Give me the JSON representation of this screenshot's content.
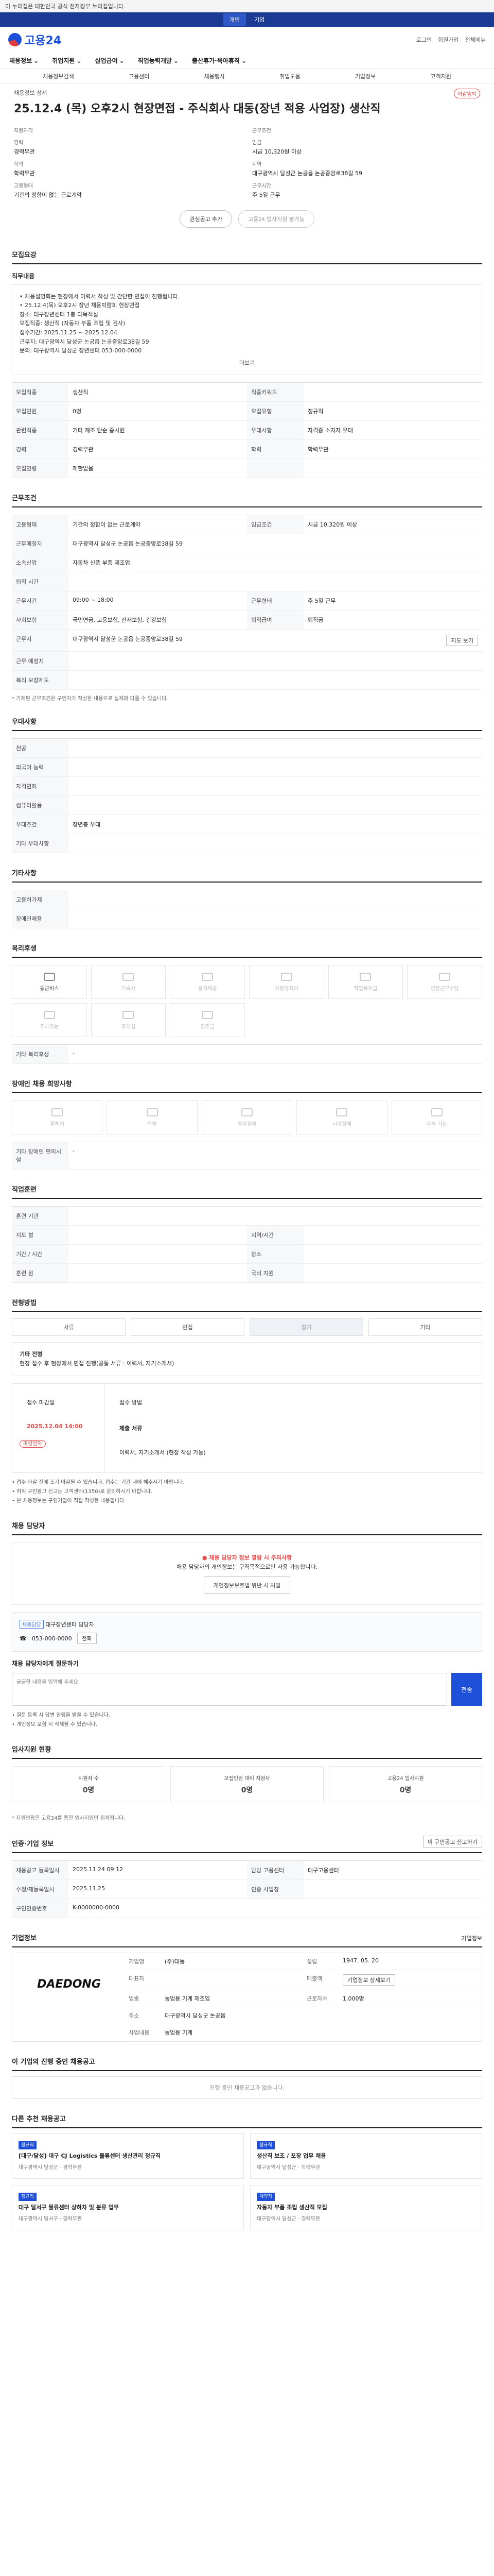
{
  "notice": "이 누리집은 대한민국 공식 전자정부 누리집입니다.",
  "govbar": {
    "items": [
      "개인",
      "기업"
    ]
  },
  "header": {
    "logo_text": "고용24",
    "links": [
      "로그인",
      "회원가입",
      "전체메뉴"
    ]
  },
  "gnb": [
    "채용정보",
    "취업지원",
    "실업급여",
    "직업능력개발",
    "출산휴가·육아휴직"
  ],
  "subnav": [
    "채용정보검색",
    "고용센터",
    "채용행사",
    "취업도움",
    "기업정보",
    "고객지원"
  ],
  "job": {
    "breadcrumb": "채용정보 상세",
    "badge": "마감임박",
    "title": "25.12.4 (목) 오후2시 현장면접 - 주식회사 대동(장년 적용 사업장) 생산직",
    "kv": [
      {
        "label": "지원자격",
        "value": ""
      },
      {
        "label": "근무조건",
        "value": ""
      },
      {
        "label": "경력",
        "value": "경력무관"
      },
      {
        "label": "임금",
        "value": "시급 10,320원 이상"
      },
      {
        "label": "학력",
        "value": "학력무관"
      },
      {
        "label": "지역",
        "value": "대구광역시 달성군 논공읍 논공중앙로38길 59"
      },
      {
        "label": "고용형태",
        "value": ""
      },
      {
        "label": "근무시간",
        "value": ""
      },
      {
        "label": "",
        "value": "기간의 정함이 없는 근로계약"
      },
      {
        "label": "",
        "value": "주 5일 근무"
      }
    ],
    "btn_interest": "관심공고 추가",
    "btn_apply": "고용24 입사지원 불가능"
  },
  "recruit": {
    "title": "모집요강",
    "content_title": "직무내용",
    "content_lines": [
      "• 채용설명회는 현장에서 이력서 작성 및 간단한 면접이 진행됩니다.",
      "• 25.12.4(목) 오후2시 장년 채용박람회 현장면접",
      "장소: 대구장년센터 1층 다목적실",
      "모집직종: 생산직 (자동차 부품 조립 및 검사)",
      "접수기간: 2025.11.25 ~ 2025.12.04",
      "근무지: 대구광역시 달성군 논공읍 논공중앙로38길 59",
      "문의: 대구광역시 달성군 장년센터 053-000-0000"
    ],
    "more": "더보기",
    "rows": [
      [
        "모집직종",
        "생산직",
        "직종키워드",
        ""
      ],
      [
        "모집인원",
        "0명",
        "모집유형",
        "정규직"
      ],
      [
        "관련직종",
        "기타 제조 단순 종사원",
        "우대사항",
        "자격증 소지자 우대"
      ],
      [
        "경력",
        "경력무관",
        "학력",
        "학력무관"
      ],
      [
        "모집연령",
        "제한없음",
        "",
        ""
      ]
    ]
  },
  "work": {
    "title": "근무조건",
    "rows": [
      [
        "고용형태",
        "기간의 정함이 없는 근로계약",
        "임금조건",
        "시급 10,320원 이상"
      ],
      [
        "근무예정지",
        "대구광역시 달성군 논공읍 논공중앙로38길 59",
        "",
        ""
      ],
      [
        "소속산업",
        "자동차 신품 부품 제조업",
        "",
        ""
      ],
      [
        "퇴직 시간",
        "",
        "",
        ""
      ],
      [
        "근무시간",
        "09:00 ~ 18:00",
        "근무형태",
        "주 5일 근무"
      ],
      [
        "사회보험",
        "국민연금, 고용보험, 산재보험, 건강보험",
        "퇴직급여",
        "퇴직금"
      ],
      [
        "근무지",
        "대구광역시 달성군 논공읍 논공중앙로38길 59",
        "",
        ""
      ],
      [
        "근무 예정지",
        "",
        "",
        ""
      ],
      [
        "복리 보장제도",
        "",
        "",
        ""
      ]
    ],
    "map_btn": "지도 보기",
    "footnote": "* 기재된 근무조건은 구인자가 작성한 내용으로 실제와 다를 수 있습니다."
  },
  "prefer": {
    "title": "우대사항",
    "rows": [
      [
        "전공",
        ""
      ],
      [
        "외국어 능력",
        ""
      ],
      [
        "자격면허",
        ""
      ],
      [
        "컴퓨터활용",
        ""
      ],
      [
        "우대조건",
        "장년층 우대"
      ],
      [
        "기타 우대사항",
        ""
      ]
    ]
  },
  "etc": {
    "title": "기타사항",
    "rows": [
      [
        "고용허가제",
        ""
      ],
      [
        "장애인채용",
        ""
      ]
    ]
  },
  "welfare": {
    "title": "복리후생",
    "items": [
      "통근버스",
      "기숙사",
      "중식제공",
      "차량유지비",
      "작업복지급",
      "연장근무수당",
      "주차가능",
      "휴게실",
      "경조금"
    ],
    "dim_from": 1,
    "etc_label": "기타 복리후생",
    "etc_value": "-"
  },
  "disability": {
    "title": "장애인 채용 희망사항",
    "items": [
      "휠체어",
      "목발",
      "청각장애",
      "시각장애",
      "주차 가능"
    ],
    "etc_label": "기타 장애인 편의시설",
    "etc_value": "-"
  },
  "career": {
    "title": "직업훈련",
    "rows": [
      [
        "훈련 기관",
        "",
        "",
        ""
      ],
      [
        "지도 형",
        "",
        "지역/시간",
        ""
      ],
      [
        "기간 / 시간",
        "",
        "장소",
        ""
      ],
      [
        "훈련 원",
        "",
        "국비 지원",
        ""
      ]
    ]
  },
  "process": {
    "title": "전형방법",
    "tabs": [
      "서류",
      "면접",
      "필기",
      "기타"
    ],
    "etc_title": "기타 전형",
    "etc_text": "현장 접수 후 현장에서 면접 진행(공통 서류 : 이력서, 자기소개서)",
    "deadline_label": "접수 마감일",
    "deadline": "2025.12.04 14:00",
    "deadline_tag": "마감임박",
    "method_label": "접수 방법",
    "method_title": "제출 서류",
    "method_text": "이력서, 자기소개서 (현장 작성 가능)",
    "notes": [
      "• 접수 마감 전에 조기 마감될 수 있습니다. 접수는 기간 내에 해주시기 바랍니다.",
      "• 허위 구인광고 신고는 고객센터(1350)로 문의하시기 바랍니다.",
      "• 본 채용정보는 구인기업이 직접 작성한 내용입니다."
    ]
  },
  "contact_info": {
    "title": "채용 담당자",
    "alert_title": "채용 담당자 정보 열람 시 주의사항",
    "alert_text": "채용 담당자의 개인정보는 구직목적으로만 사용 가능합니다.",
    "alert_btn": "개인정보보호법 위반 시 처벌",
    "contact_tag": "채용담당",
    "contact_name": "대구장년센터 담당자",
    "contact_phone": "053-000-0000",
    "call_btn": "전화",
    "inquiry_title": "채용 담당자에게 질문하기",
    "inquiry_placeholder": "궁금한 내용을 입력해 주세요.",
    "inquiry_btn": "전송",
    "inquiry_notes": [
      "• 질문 등록 시 답변 알림을 받을 수 있습니다.",
      "• 개인정보 포함 시 삭제될 수 있습니다."
    ]
  },
  "applicants": {
    "title": "입사지원 현황",
    "items": [
      [
        "지원자 수",
        "0명"
      ],
      [
        "모집인원 대비 지원자",
        "0명"
      ],
      [
        "고용24 입사지원",
        "0명"
      ]
    ],
    "note": "* 지원현황은 고용24를 통한 입사지원만 집계됩니다."
  },
  "registration": {
    "title": "인증·기업 정보",
    "btn": "이 구인공고 신고하기",
    "rows": [
      [
        "채용공고 등록일시",
        "2025.11.24 09:12",
        "담당 고용센터",
        "대구고용센터"
      ],
      [
        "수정/재등록일시",
        "2025.11.25",
        "인증 사업장",
        ""
      ],
      [
        "구인인증번호",
        "K-0000000-0000",
        "",
        ""
      ]
    ]
  },
  "company": {
    "title": "기업정보",
    "btn": "기업정보",
    "logo_text": "DAEDONG",
    "rows": [
      [
        "기업명",
        "(주)대동",
        "설립",
        "1947. 05. 20"
      ],
      [
        "대표자",
        "",
        "매출액",
        "",
        ""
      ],
      [
        "업종",
        "농업용 기계 제조업",
        "근로자수",
        "1,000명"
      ],
      [
        "주소",
        "대구광역시 달성군 논공읍",
        "",
        ""
      ],
      [
        "사업내용",
        "농업용 기계",
        "",
        ""
      ]
    ],
    "detail_btn": "기업정보 상세보기"
  },
  "same_company": {
    "title": "이 기업의 진행 중인 채용공고",
    "empty": "진행 중인 채용공고가 없습니다."
  },
  "recommend": {
    "title": "다른 추천 채용공고",
    "cards": [
      {
        "chip": "정규직",
        "title": "[대구/달성] 대구 CJ Logistics 물류센터 생산관리 정규직",
        "meta": "대구광역시 달성군 · 경력무관"
      },
      {
        "chip": "정규직",
        "title": "생산직 보조 / 포장 업무 채용",
        "meta": "대구광역시 달성군 · 학력무관"
      },
      {
        "chip": "정규직",
        "title": "대구 달서구 물류센터 상하차 및 분류 업무",
        "meta": "대구광역시 달서구 · 경력무관"
      },
      {
        "chip": "계약직",
        "title": "자동차 부품 조립 생산직 모집",
        "meta": "대구광역시 달성군 · 경력무관"
      }
    ]
  }
}
